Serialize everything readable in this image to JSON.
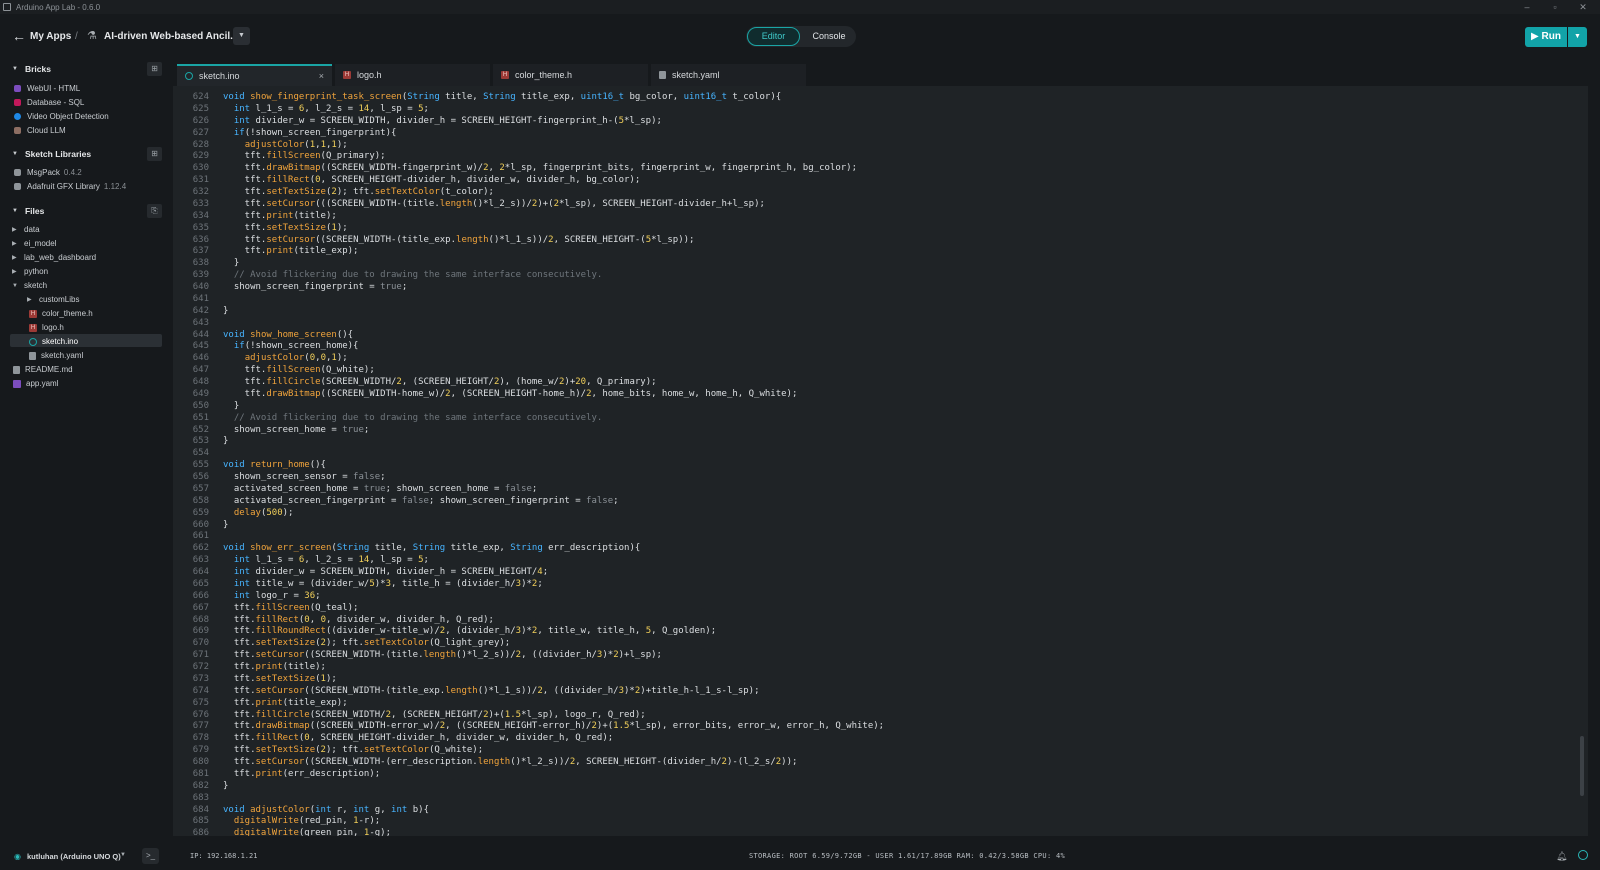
{
  "window": {
    "title": "Arduino App Lab - 0.6.0",
    "controls": {
      "minimize": "–",
      "maximize": "▫",
      "close": "✕"
    }
  },
  "header": {
    "back_icon": "arrow-left-icon",
    "breadcrumb_root": "My Apps",
    "breadcrumb_sep": "/",
    "project_name": "AI-driven Web-based Ancil...",
    "view_tabs": {
      "editor": "Editor",
      "console": "Console",
      "active": "Editor"
    },
    "run_label": "▶ Run",
    "accent_color": "#12a3a8"
  },
  "sidebar": {
    "bricks": {
      "title": "Bricks",
      "items": [
        {
          "label": "WebUI - HTML",
          "color": "#7c4dbe"
        },
        {
          "label": "Database - SQL",
          "color": "#c2185b"
        },
        {
          "label": "Video Object Detection",
          "color": "#1e88e5"
        },
        {
          "label": "Cloud LLM",
          "color": "#8d6e63"
        }
      ]
    },
    "libraries": {
      "title": "Sketch Libraries",
      "items": [
        {
          "label": "MsgPack",
          "version": "0.4.2"
        },
        {
          "label": "Adafruit GFX Library",
          "version": "1.12.4"
        }
      ]
    },
    "files": {
      "title": "Files",
      "folders": [
        "data",
        "ei_model",
        "lab_web_dashboard",
        "python"
      ],
      "sketch_folder": "sketch",
      "sketch_children": {
        "subfolder": "customLibs",
        "files": [
          "color_theme.h",
          "logo.h",
          "sketch.ino",
          "sketch.yaml"
        ]
      },
      "root_files": [
        "README.md",
        "app.yaml"
      ],
      "selected": "sketch.ino"
    }
  },
  "tabs": [
    {
      "label": "sketch.ino",
      "type": "ino",
      "active": true,
      "close": "×"
    },
    {
      "label": "logo.h",
      "type": "h",
      "active": false
    },
    {
      "label": "color_theme.h",
      "type": "h",
      "active": false
    },
    {
      "label": "sketch.yaml",
      "type": "yaml",
      "active": false
    }
  ],
  "editor": {
    "language": "arduino-cpp",
    "first_line": 624,
    "lines": [
      "void show_fingerprint_task_screen(String title, String title_exp, uint16_t bg_color, uint16_t t_color){",
      "  int l_1_s = 6, l_2_s = 14, l_sp = 5;",
      "  int divider_w = SCREEN_WIDTH, divider_h = SCREEN_HEIGHT-fingerprint_h-(5*l_sp);",
      "  if(!shown_screen_fingerprint){",
      "    adjustColor(1,1,1);",
      "    tft.fillScreen(Q_primary);",
      "    tft.drawBitmap((SCREEN_WIDTH-fingerprint_w)/2, 2*l_sp, fingerprint_bits, fingerprint_w, fingerprint_h, bg_color);",
      "    tft.fillRect(0, SCREEN_HEIGHT-divider_h, divider_w, divider_h, bg_color);",
      "    tft.setTextSize(2); tft.setTextColor(t_color);",
      "    tft.setCursor(((SCREEN_WIDTH-(title.length()*l_2_s))/2)+(2*l_sp), SCREEN_HEIGHT-divider_h+l_sp);",
      "    tft.print(title);",
      "    tft.setTextSize(1);",
      "    tft.setCursor((SCREEN_WIDTH-(title_exp.length()*l_1_s))/2, SCREEN_HEIGHT-(5*l_sp));",
      "    tft.print(title_exp);",
      "  }",
      "  // Avoid flickering due to drawing the same interface consecutively.",
      "  shown_screen_fingerprint = true;",
      "",
      "}",
      "",
      "void show_home_screen(){",
      "  if(!shown_screen_home){",
      "    adjustColor(0,0,1);",
      "    tft.fillScreen(Q_white);",
      "    tft.fillCircle(SCREEN_WIDTH/2, (SCREEN_HEIGHT/2), (home_w/2)+20, Q_primary);",
      "    tft.drawBitmap((SCREEN_WIDTH-home_w)/2, (SCREEN_HEIGHT-home_h)/2, home_bits, home_w, home_h, Q_white);",
      "  }",
      "  // Avoid flickering due to drawing the same interface consecutively.",
      "  shown_screen_home = true;",
      "}",
      "",
      "void return_home(){",
      "  shown_screen_sensor = false;",
      "  activated_screen_home = true; shown_screen_home = false;",
      "  activated_screen_fingerprint = false; shown_screen_fingerprint = false;",
      "  delay(500);",
      "}",
      "",
      "void show_err_screen(String title, String title_exp, String err_description){",
      "  int l_1_s = 6, l_2_s = 14, l_sp = 5;",
      "  int divider_w = SCREEN_WIDTH, divider_h = SCREEN_HEIGHT/4;",
      "  int title_w = (divider_w/5)*3, title_h = (divider_h/3)*2;",
      "  int logo_r = 36;",
      "  tft.fillScreen(Q_teal);",
      "  tft.fillRect(0, 0, divider_w, divider_h, Q_red);",
      "  tft.fillRoundRect((divider_w-title_w)/2, (divider_h/3)*2, title_w, title_h, 5, Q_golden);",
      "  tft.setTextSize(2); tft.setTextColor(Q_light_grey);",
      "  tft.setCursor((SCREEN_WIDTH-(title.length()*l_2_s))/2, ((divider_h/3)*2)+l_sp);",
      "  tft.print(title);",
      "  tft.setTextSize(1);",
      "  tft.setCursor((SCREEN_WIDTH-(title_exp.length()*l_1_s))/2, ((divider_h/3)*2)+title_h-l_1_s-l_sp);",
      "  tft.print(title_exp);",
      "  tft.fillCircle(SCREEN_WIDTH/2, (SCREEN_HEIGHT/2)+(1.5*l_sp), logo_r, Q_red);",
      "  tft.drawBitmap((SCREEN_WIDTH-error_w)/2, ((SCREEN_HEIGHT-error_h)/2)+(1.5*l_sp), error_bits, error_w, error_h, Q_white);",
      "  tft.fillRect(0, SCREEN_HEIGHT-divider_h, divider_w, divider_h, Q_red);",
      "  tft.setTextSize(2); tft.setTextColor(Q_white);",
      "  tft.setCursor((SCREEN_WIDTH-(err_description.length()*l_2_s))/2, SCREEN_HEIGHT-(divider_h/2)-(l_2_s/2));",
      "  tft.print(err_description);",
      "}",
      "",
      "void adjustColor(int r, int g, int b){",
      "  digitalWrite(red_pin, 1-r);",
      "  digitalWrite(green_pin, 1-g);"
    ]
  },
  "statusbar": {
    "board": "kutluhan (Arduino UNO Q)",
    "ip": "IP: 192.168.1.21",
    "stats": "STORAGE: ROOT 6.59/9.72GB - USER 1.61/17.89GB   RAM: 0.42/3.58GB   CPU: 4%"
  }
}
